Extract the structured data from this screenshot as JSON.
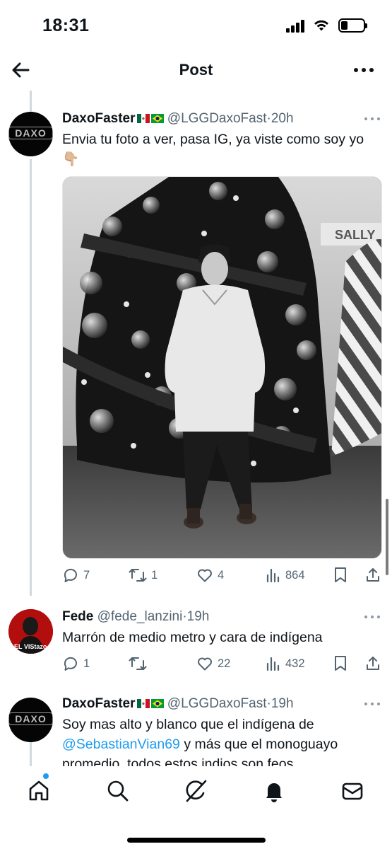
{
  "status_bar": {
    "time": "18:31"
  },
  "header": {
    "title": "Post"
  },
  "tweets": [
    {
      "author": "DaxoFaster",
      "handle": "@LGGDaxoFast",
      "separator": "·",
      "time": "20h",
      "avatar_text": "DAXO",
      "flags": [
        "mexico-flag",
        "brazil-flag"
      ],
      "text": "Envia tu foto a ver, pasa IG, ya viste como soy yo",
      "emoji": "👇🏼",
      "media_description": "photo",
      "replies": "7",
      "reposts": "1",
      "likes": "4",
      "views": "864"
    },
    {
      "author": "Fede",
      "handle": "@fede_lanzini",
      "separator": "·",
      "time": "19h",
      "avatar_text": "EL VIStazo",
      "text": "Marrón de medio metro y cara de indígena",
      "replies": "1",
      "reposts": "",
      "likes": "22",
      "views": "432"
    },
    {
      "author": "DaxoFaster",
      "handle": "@LGGDaxoFast",
      "separator": "·",
      "time": "19h",
      "avatar_text": "DAXO",
      "flags": [
        "mexico-flag",
        "brazil-flag"
      ],
      "text_part1": "Soy mas alto y blanco que el indígena de",
      "mention": "@SebastianVian69",
      "text_part2": " y más que el monoguayo",
      "text_part3": "promedio, todos estos indios son feos"
    }
  ],
  "colors": {
    "text": "#0f1419",
    "secondary": "#536471",
    "accent": "#1d9bf0",
    "thread_line": "#cfd9de"
  }
}
